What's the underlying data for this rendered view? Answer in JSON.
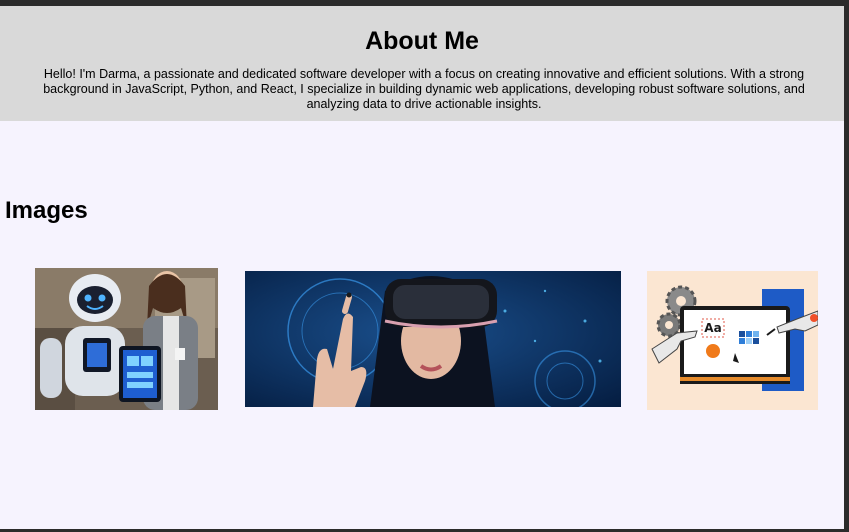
{
  "about": {
    "title": "About Me",
    "text": "Hello! I'm Darma, a passionate and dedicated software developer with a focus on creating innovative and efficient solutions. With a strong background in JavaScript, Python, and React, I specialize in building dynamic web applications, developing robust software solutions, and analyzing data to drive actionable insights."
  },
  "images": {
    "title": "Images",
    "items": [
      {
        "icon": "robot-and-woman-with-tablet-photo"
      },
      {
        "icon": "woman-vr-headset-photo"
      },
      {
        "icon": "design-tools-illustration"
      }
    ],
    "design_label": "Aa"
  },
  "colors": {
    "header_bg": "#d9d9d9",
    "page_bg": "#f6f3fe",
    "frame_border": "#2b2b2b"
  }
}
